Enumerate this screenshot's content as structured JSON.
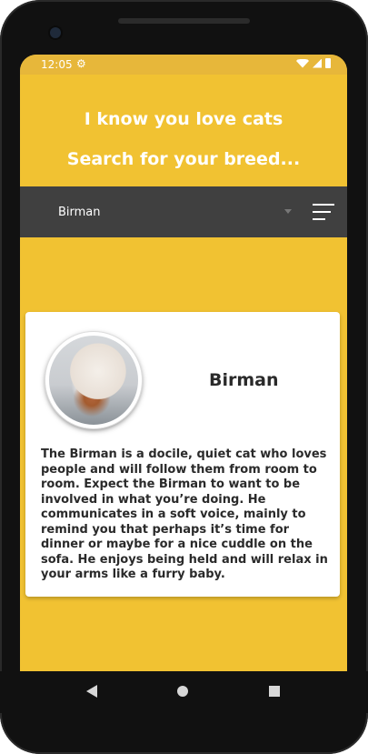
{
  "status": {
    "time": "12:05"
  },
  "header": {
    "title_line1": "I know you love cats",
    "title_line2": "Search for your breed..."
  },
  "search": {
    "selected_breed": "Birman"
  },
  "breed_card": {
    "name": "Birman",
    "description": "The Birman is a docile, quiet cat who loves people and will follow them from room to room. Expect the Birman to want to be involved in what you’re doing. He communicates in a soft voice, mainly to remind you that perhaps it’s time for dinner or maybe for a nice cuddle on the sofa. He enjoys being held and will relax in your arms like a furry baby."
  },
  "icons": {
    "status": [
      "gear-icon",
      "wifi-icon",
      "signal-icon",
      "battery-icon"
    ],
    "nav": [
      "back-icon",
      "home-icon",
      "recents-icon"
    ],
    "search": [
      "dropdown-arrow-icon",
      "filter-icon"
    ]
  },
  "colors": {
    "background": "#f1c232",
    "search_bar": "#404040",
    "card": "#ffffff",
    "text_dark": "#2a2a2a"
  }
}
